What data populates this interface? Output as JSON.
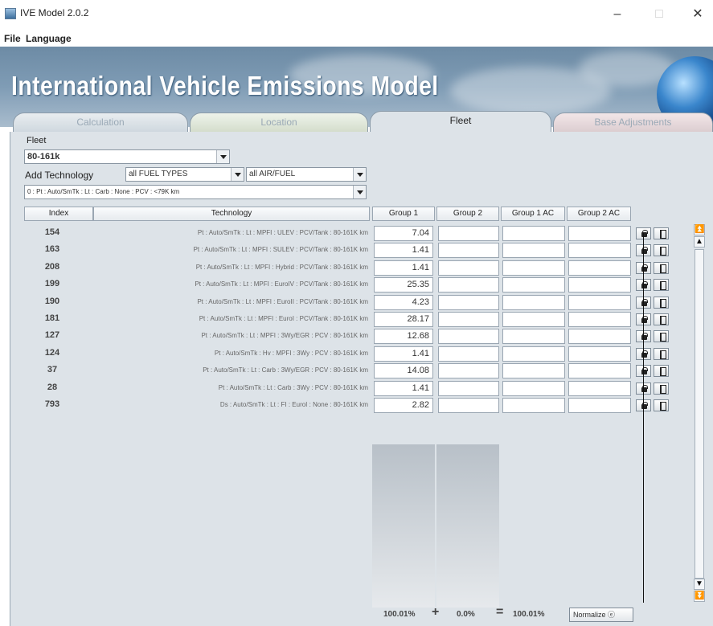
{
  "window": {
    "title": "IVE Model 2.0.2",
    "minimize": "–",
    "maximize": "□",
    "close": "✕"
  },
  "menu": [
    {
      "label": "File"
    },
    {
      "label": "Language"
    }
  ],
  "banner": {
    "title": "International Vehicle Emissions Model"
  },
  "tabs": [
    {
      "label": "Calculation",
      "active": false
    },
    {
      "label": "Location",
      "active": false
    },
    {
      "label": "Fleet",
      "active": true
    },
    {
      "label": "Base Adjustments",
      "active": false
    }
  ],
  "fleet": {
    "label": "Fleet",
    "selected": "80-161k",
    "add_tech_label": "Add Technology",
    "fuel_filter": "all FUEL TYPES",
    "airfuel_filter": "all AIR/FUEL",
    "tech_select": "0 : Pt : Auto/SmTk : Lt : Carb : None : PCV : <79K km"
  },
  "table": {
    "headers": {
      "index": "Index",
      "technology": "Technology",
      "group1": "Group 1",
      "group2": "Group 2",
      "group1ac": "Group 1 AC",
      "group2ac": "Group 2 AC"
    },
    "rows": [
      {
        "index": "154",
        "tech": "Pt : Auto/SmTk : Lt : MPFI : ULEV : PCV/Tank : 80-161K km",
        "group1": "7.04"
      },
      {
        "index": "163",
        "tech": "Pt : Auto/SmTk : Lt : MPFI : SULEV : PCV/Tank : 80-161K km",
        "group1": "1.41"
      },
      {
        "index": "208",
        "tech": "Pt : Auto/SmTk : Lt : MPFI : Hybrid : PCV/Tank : 80-161K km",
        "group1": "1.41"
      },
      {
        "index": "199",
        "tech": "Pt : Auto/SmTk : Lt : MPFI : EuroIV : PCV/Tank : 80-161K km",
        "group1": "25.35"
      },
      {
        "index": "190",
        "tech": "Pt : Auto/SmTk : Lt : MPFI : EuroII : PCV/Tank : 80-161K km",
        "group1": "4.23"
      },
      {
        "index": "181",
        "tech": "Pt : Auto/SmTk : Lt : MPFI : EuroI : PCV/Tank : 80-161K km",
        "group1": "28.17"
      },
      {
        "index": "127",
        "tech": "Pt : Auto/SmTk : Lt : MPFI : 3Wy/EGR : PCV : 80-161K km",
        "group1": "12.68"
      },
      {
        "index": "124",
        "tech": "Pt : Auto/SmTk : Hv : MPFI : 3Wy : PCV : 80-161K km",
        "group1": "1.41"
      },
      {
        "index": "37",
        "tech": "Pt : Auto/SmTk : Lt : Carb : 3Wy/EGR : PCV : 80-161K km",
        "group1": "14.08"
      },
      {
        "index": "28",
        "tech": "Pt : Auto/SmTk : Lt : Carb : 3Wy : PCV : 80-161K km",
        "group1": "1.41"
      },
      {
        "index": "793",
        "tech": "Ds : Auto/SmTk : Lt : FI : EuroI : None : 80-161K km",
        "group1": "2.82"
      }
    ]
  },
  "totals": {
    "group1": "100.01%",
    "plus": "+",
    "group2": "0.0%",
    "equals": "=",
    "total": "100.01%",
    "normalize": "Normalize ⓔ"
  }
}
